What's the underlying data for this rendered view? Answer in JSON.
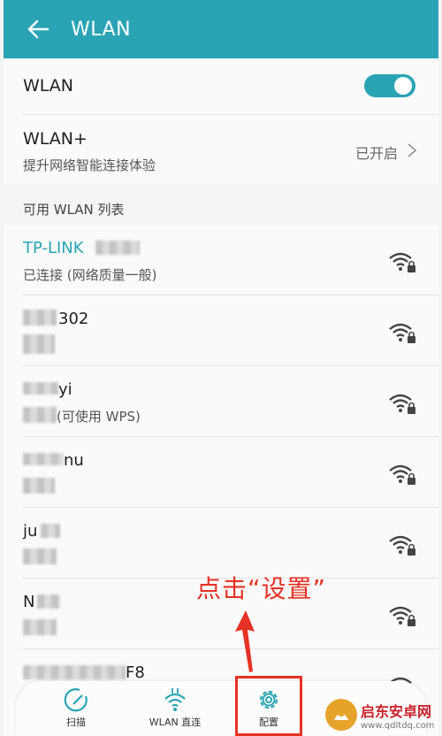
{
  "header": {
    "title": "WLAN"
  },
  "wlan_row": {
    "label": "WLAN",
    "toggle_on": true
  },
  "wlan_plus_row": {
    "label": "WLAN+",
    "subtitle": "提升网络智能连接体验",
    "value": "已开启"
  },
  "section_header": "可用 WLAN 列表",
  "networks": [
    {
      "name": "TP-LINK",
      "status": "已连接 (网络质量一般)",
      "connected": true
    },
    {
      "name": "302",
      "status": ""
    },
    {
      "name": "yi",
      "status": "(可使用 WPS)"
    },
    {
      "name": "nu",
      "status": ""
    },
    {
      "name": "ju",
      "status": ""
    },
    {
      "name": "N",
      "status": ""
    },
    {
      "name": "F8",
      "status": ""
    }
  ],
  "annotation": "点击“设置”",
  "bottom_tabs": [
    {
      "label": "扫描",
      "icon": "scan-icon"
    },
    {
      "label": "WLAN 直连",
      "icon": "wifi-direct-icon"
    },
    {
      "label": "配置",
      "icon": "gear-icon"
    }
  ],
  "watermark": {
    "title": "启东安卓网",
    "url": "www.qdltdq.com"
  },
  "colors": {
    "accent": "#2aa4b5",
    "annotation": "#e53224"
  }
}
